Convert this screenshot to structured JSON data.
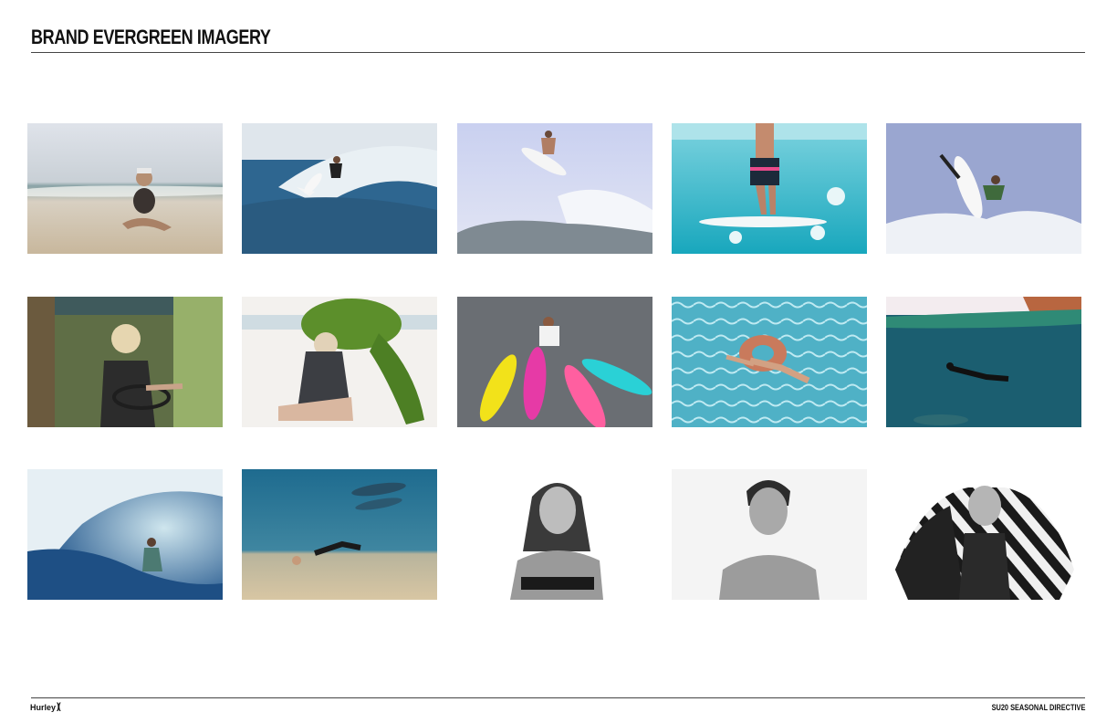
{
  "header": {
    "title": "BRAND EVERGREEN IMAGERY"
  },
  "footer": {
    "brand": "Hurley",
    "brand_mark": ")(",
    "doc_label": "SU20 SEASONAL DIRECTIVE"
  },
  "gallery": {
    "photos": [
      "woman-in-mask-sitting-on-beach",
      "surfer-carving-blue-wave",
      "surfer-aerial-over-wave",
      "underwater-man-with-surfboard",
      "surfer-aerial-spray",
      "woman-driving-vintage-car",
      "woman-holding-monstera-leaf",
      "man-with-colorful-surfboards",
      "woman-on-pool-float",
      "diver-underwater-split-shot",
      "surfer-in-barrel",
      "swimmer-with-dolphins",
      "woman-laughing-portrait-bw",
      "man-smiling-portrait-bw",
      "man-with-american-flag-bw"
    ]
  }
}
